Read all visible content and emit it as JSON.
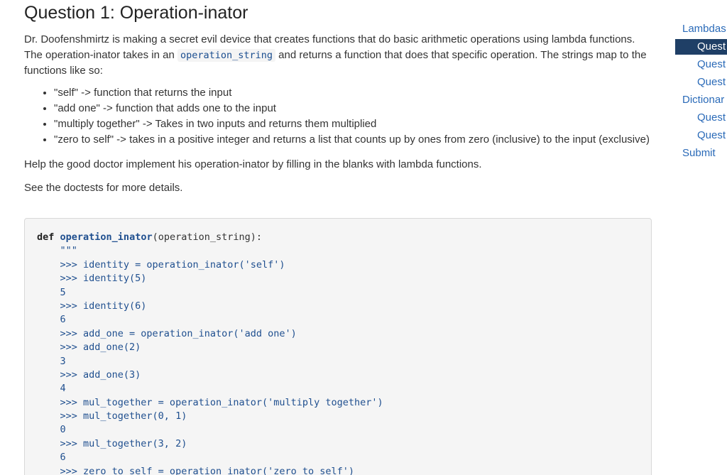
{
  "title": "Question 1: Operation-inator",
  "intro": {
    "part1": "Dr. Doofenshmirtz is making a secret evil device that creates functions that do basic arithmetic operations using lambda functions. The operation-inator takes in an ",
    "code": "operation_string",
    "part2": " and returns a function that does that specific operation. The strings map to the functions like so:"
  },
  "bullets": [
    "\"self\" -> function that returns the input",
    "\"add one\" -> function that adds one to the input",
    "\"multiply together\" -> Takes in two inputs and returns them multiplied",
    "\"zero to self\" -> takes in a positive integer and returns a list that counts up by ones from zero (inclusive) to the input (exclusive)"
  ],
  "help_text": "Help the good doctor implement his operation-inator by filling in the blanks with lambda functions.",
  "see_text": "See the doctests for more details.",
  "code": {
    "def_kw": "def",
    "fn_name": "operation_inator",
    "signature": "(operation_string):",
    "lines": [
      "    \"\"\"",
      "    >>> identity = operation_inator('self')",
      "    >>> identity(5)",
      "    5",
      "    >>> identity(6)",
      "    6",
      "    >>> add_one = operation_inator('add one')",
      "    >>> add_one(2)",
      "    3",
      "    >>> add_one(3)",
      "    4",
      "    >>> mul_together = operation_inator('multiply together')",
      "    >>> mul_together(0, 1)",
      "    0",
      "    >>> mul_together(3, 2)",
      "    6",
      "    >>> zero_to_self = operation_inator('zero to self')"
    ]
  },
  "sidebar": {
    "items": [
      {
        "label": "Lambdas",
        "level": 1,
        "active": false
      },
      {
        "label": "Quest",
        "level": 2,
        "active": true
      },
      {
        "label": "Quest",
        "level": 2,
        "active": false
      },
      {
        "label": "Quest",
        "level": 2,
        "active": false
      },
      {
        "label": "Dictionar",
        "level": 1,
        "active": false
      },
      {
        "label": "Quest",
        "level": 2,
        "active": false
      },
      {
        "label": "Quest",
        "level": 2,
        "active": false
      },
      {
        "label": "Submit",
        "level": 1,
        "active": false
      }
    ]
  },
  "colors": {
    "link": "#2a6ab8",
    "active_bg": "#1f3f66",
    "code_bg": "#f5f5f5",
    "code_accent": "#1f4f8f"
  }
}
